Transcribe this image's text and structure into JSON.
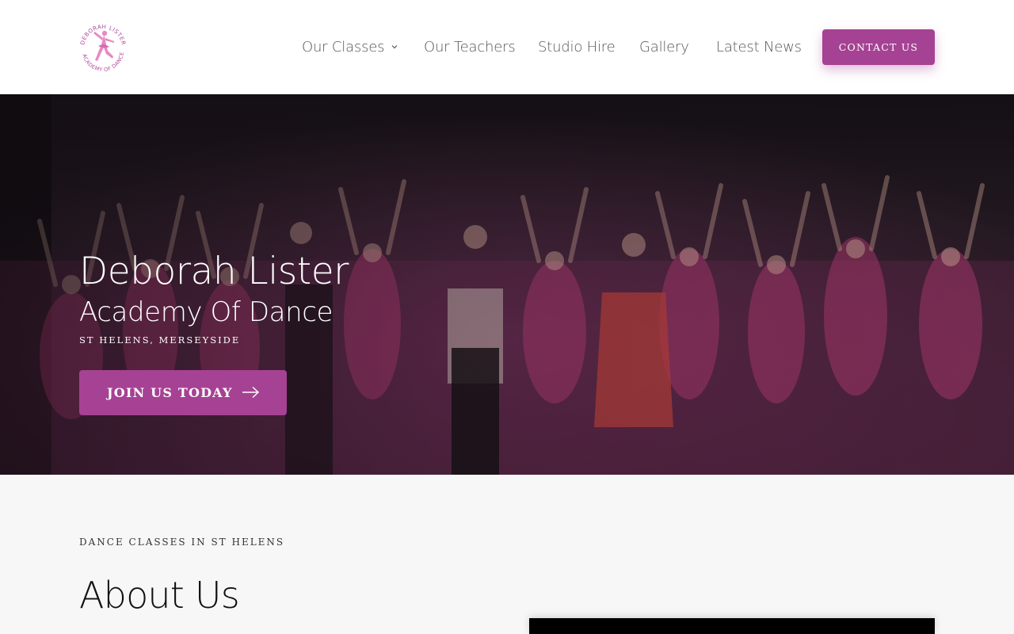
{
  "brand": {
    "logo_alt": "Deborah Lister Academy of Dance logo",
    "logo_text_top": "DEBORAH LISTER",
    "logo_text_bottom": "ACADEMY OF DANCE",
    "accent_color": "#a64293"
  },
  "nav": {
    "items": [
      {
        "label": "Our Classes",
        "has_dropdown": true
      },
      {
        "label": "Our Teachers"
      },
      {
        "label": "Studio Hire"
      },
      {
        "label": "Gallery"
      },
      {
        "label": "Latest News"
      }
    ],
    "contact_label": "CONTACT US"
  },
  "hero": {
    "title": "Deborah Lister",
    "subtitle": "Academy Of Dance",
    "location": "ST HELENS, MERSEYSIDE",
    "cta_label": "JOIN US TODAY",
    "cta_icon": "arrow-right-icon"
  },
  "about": {
    "eyebrow": "DANCE CLASSES IN ST HELENS",
    "title": "About Us"
  }
}
